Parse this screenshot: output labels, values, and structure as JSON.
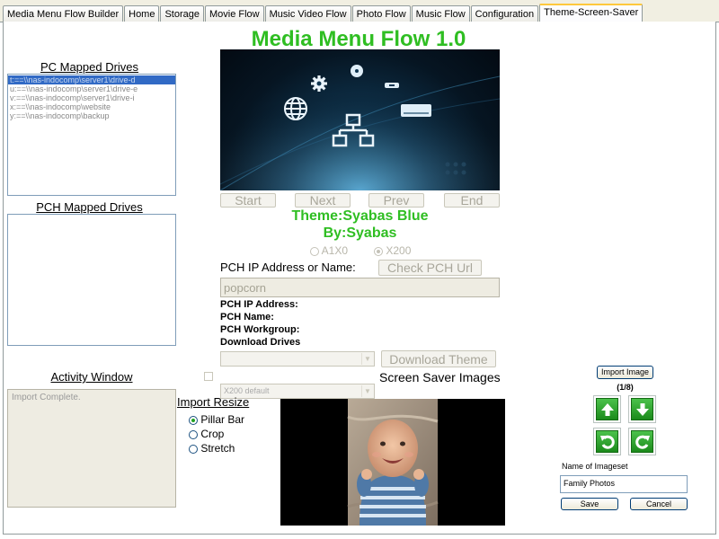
{
  "tabs": [
    {
      "label": "Media Menu Flow Builder"
    },
    {
      "label": "Home"
    },
    {
      "label": "Storage"
    },
    {
      "label": "Movie Flow"
    },
    {
      "label": "Music Video Flow"
    },
    {
      "label": "Photo Flow"
    },
    {
      "label": "Music Flow"
    },
    {
      "label": "Configuration"
    },
    {
      "label": "Theme-Screen-Saver",
      "active": true
    }
  ],
  "header": {
    "title": "Media Menu Flow 1.0"
  },
  "pc_drives": {
    "label": "PC  Mapped Drives",
    "items": [
      "t:==\\\\nas-indocomp\\server1\\drive-d",
      "u:==\\\\nas-indocomp\\server1\\drive-e",
      "v:==\\\\nas-indocomp\\server1\\drive-i",
      "x:==\\\\nas-indocomp\\website",
      "y:==\\\\nas-indocomp\\backup"
    ]
  },
  "pch_drives": {
    "label": "PCH Mapped Drives",
    "items": []
  },
  "activity": {
    "label": "Activity Window",
    "text": "Import Complete."
  },
  "preview_nav": {
    "start": "Start",
    "next": "Next",
    "prev": "Prev",
    "end": "End"
  },
  "theme": {
    "name": "Theme:Syabas Blue",
    "author": "By:Syabas"
  },
  "model": {
    "a1x0": "A1X0",
    "x200": "X200",
    "selected": "X200"
  },
  "pch": {
    "ip_label": "PCH IP Address or Name:",
    "check_button": "Check PCH Url",
    "ip_value": "popcorn",
    "info_ip": "PCH IP Address:",
    "info_name": "PCH Name:",
    "info_workgroup": "PCH Workgroup:",
    "download_drives": "Download Drives",
    "download_theme": "Download Theme"
  },
  "screensaver": {
    "combo_value": "X200 default",
    "label": "Screen Saver Images"
  },
  "resize": {
    "label": "Import Resize",
    "options": [
      "Pillar Bar",
      "Crop",
      "Stretch"
    ],
    "selected": "Pillar Bar"
  },
  "imageset": {
    "import_button": "Import Image",
    "counter": "(1/8)",
    "name_label": "Name of Imageset",
    "name_value": "Family Photos",
    "save": "Save",
    "cancel": "Cancel"
  },
  "colors": {
    "accent_green": "#2fbe22",
    "tab_highlight": "#ffc83c",
    "selection": "#316ac5"
  },
  "icons": [
    "settings-gear-icon",
    "disc-icon",
    "globe-icon",
    "usb-icon",
    "drive-icon",
    "network-icon",
    "arrow-up-icon",
    "arrow-down-icon",
    "rotate-left-icon",
    "rotate-right-icon"
  ]
}
